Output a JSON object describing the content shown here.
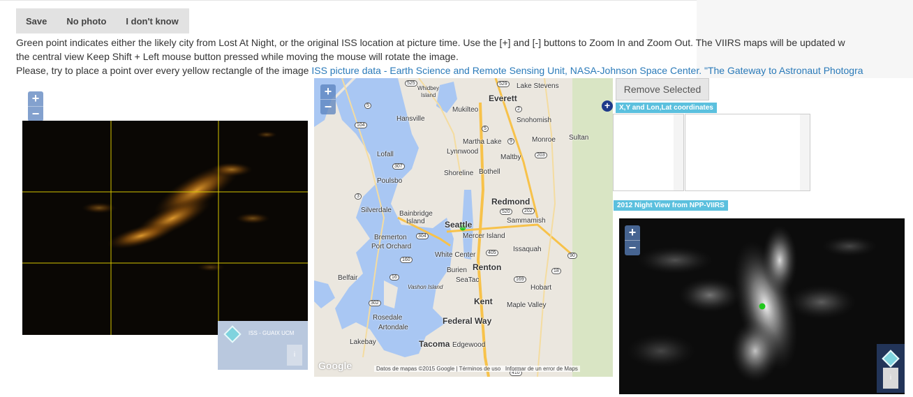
{
  "toolbar": {
    "save_label": "Save",
    "no_photo_label": "No photo",
    "dont_know_label": "I don't know"
  },
  "instructions": {
    "line1": "Green point indicates either the likely city from Lost At Night, or the original ISS location at picture time. Use the [+] and [-] buttons to Zoom In and Zoom Out. The VIIRS maps will be updated w",
    "line2": "the central view Keep Shift + Left mouse button pressed while moving the mouse will rotate the image.",
    "line3_prefix": "Please, try to place a point over every yellow rectangle of the image ",
    "link1": "ISS picture data - Earth Science and Remote Sensing Unit, NASA-Johnson Space Center.",
    "link2": "\"The Gateway to Astronaut Photogra"
  },
  "iss_panel": {
    "zoom_in": "+",
    "zoom_out": "−",
    "attribution": "ISS - GUAIX UCM",
    "attribution_button": "i"
  },
  "map_panel": {
    "zoom_in": "+",
    "zoom_out": "−",
    "google_logo": "Google",
    "footer_data": "Datos de mapas ©2015 Google",
    "footer_terms": "Términos de uso",
    "footer_report": "Informar de un error de Maps",
    "places": {
      "everett": "Everett",
      "mukilteo": "Mukilteo",
      "snohomish": "Snohomish",
      "whidbey": "Whidbey",
      "island": "Island",
      "lake_stevens": "Lake Stevens",
      "hansville": "Hansville",
      "martha_lake": "Martha Lake",
      "monroe": "Monroe",
      "sultan": "Sultan",
      "lofall": "Lofall",
      "lynnwood": "Lynnwood",
      "maltby": "Maltby",
      "poulsbo": "Poulsbo",
      "shoreline": "Shoreline",
      "bothell": "Bothell",
      "silverdale": "Silverdale",
      "bainbridge": "Bainbridge",
      "bainbridge_island": "Island",
      "redmond": "Redmond",
      "seattle": "Seattle",
      "sammamish": "Sammamish",
      "bremerton": "Bremerton",
      "port_orchard": "Port Orchard",
      "mercer_island": "Mercer Island",
      "white_center": "White Center",
      "issaquah": "Issaquah",
      "burien": "Burien",
      "renton": "Renton",
      "belfair": "Belfair",
      "seatac": "SeaTac",
      "vashon": "Vashon Island",
      "hobart": "Hobart",
      "kent": "Kent",
      "maple_valley": "Maple Valley",
      "rosedale": "Rosedale",
      "artondale": "Artondale",
      "federal_way": "Federal Way",
      "lakebay": "Lakebay",
      "tacoma": "Tacoma",
      "edgewood": "Edgewood"
    },
    "shields": {
      "s525": "525",
      "s529": "529",
      "s5a": "5",
      "s2": "2",
      "s104": "104",
      "s5b": "5",
      "s9": "9",
      "s203": "203",
      "s307": "307",
      "s3": "3",
      "s520": "520",
      "s202": "202",
      "s304": "304",
      "s405": "405",
      "s90": "90",
      "s160": "160",
      "s18": "18",
      "s16": "16",
      "s169": "169",
      "s302": "302",
      "s410": "410"
    }
  },
  "side": {
    "remove_selected": "Remove Selected",
    "add_button": "+",
    "coords_tag": "X,Y and Lon,Lat coordinates",
    "viirs_tag": "2012 Night View from NPP-VIIRS",
    "xy_value": "",
    "lonlat_value": ""
  },
  "viirs_panel": {
    "zoom_in": "+",
    "zoom_out": "−",
    "info_button": "i"
  },
  "colors": {
    "accent_tag": "#5bc0de",
    "link": "#2a7ab9",
    "marker": "#22c81e",
    "grid_line": "#d7c600"
  }
}
